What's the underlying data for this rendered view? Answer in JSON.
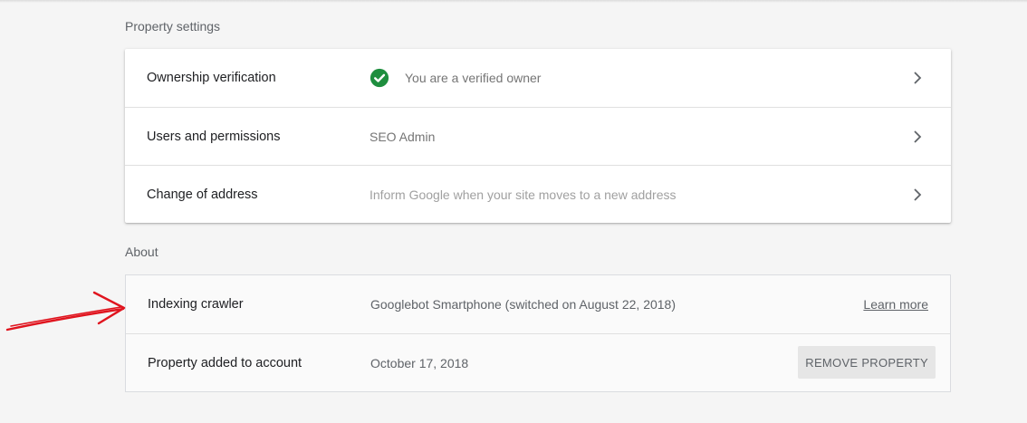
{
  "property_settings": {
    "title": "Property settings",
    "rows": [
      {
        "label": "Ownership verification",
        "value": "You are a verified owner",
        "icon": "check-circle-icon"
      },
      {
        "label": "Users and permissions",
        "value": "SEO Admin"
      },
      {
        "label": "Change of address",
        "value": "Inform Google when your site moves to a new address"
      }
    ]
  },
  "about": {
    "title": "About",
    "rows": [
      {
        "label": "Indexing crawler",
        "value": "Googlebot Smartphone (switched on August 22, 2018)",
        "action": "Learn more"
      },
      {
        "label": "Property added to account",
        "value": "October 17, 2018",
        "action": "REMOVE PROPERTY"
      }
    ]
  },
  "colors": {
    "verified_green": "#1e8e3e",
    "annotation_red": "#e0141e"
  }
}
